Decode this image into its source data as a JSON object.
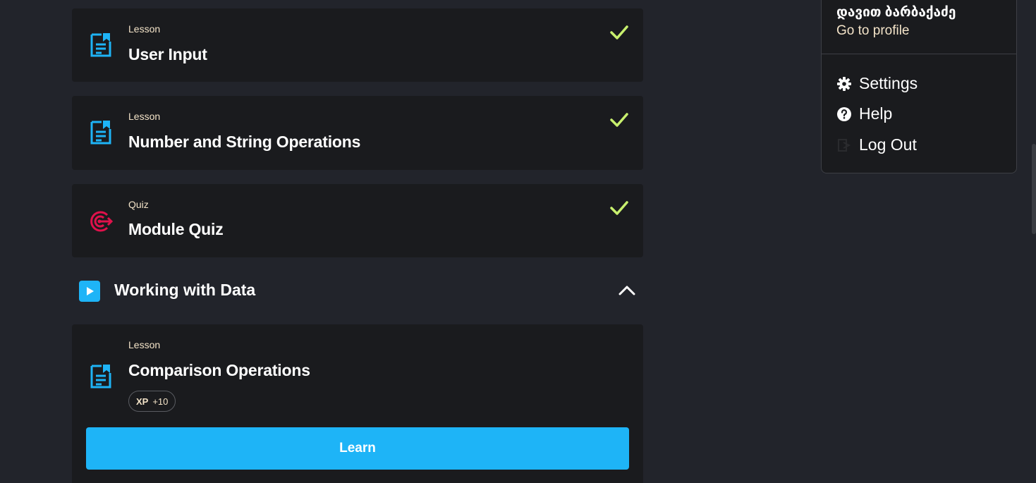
{
  "lessons": [
    {
      "type": "Lesson",
      "title": "User Input",
      "completed": true,
      "icon": "lesson-doc-icon"
    },
    {
      "type": "Lesson",
      "title": "Number and String Operations",
      "completed": true,
      "icon": "lesson-doc-icon"
    },
    {
      "type": "Quiz",
      "title": "Module Quiz",
      "completed": true,
      "icon": "quiz-target-icon"
    }
  ],
  "section": {
    "title": "Working with Data",
    "icon": "play-icon",
    "expanded": true
  },
  "current_lesson": {
    "type": "Lesson",
    "title": "Comparison Operations",
    "xp_label": "XP",
    "xp_value": "+10",
    "button_label": "Learn",
    "icon": "lesson-doc-icon"
  },
  "user_menu": {
    "user_name": "დავით ბარბაქაძე",
    "profile_link": "Go to profile",
    "items": [
      {
        "label": "Settings",
        "icon": "gear-icon"
      },
      {
        "label": "Help",
        "icon": "help-circle-icon"
      },
      {
        "label": "Log Out",
        "icon": "logout-icon"
      }
    ]
  },
  "colors": {
    "background": "#22242b",
    "card": "#1a1b1e",
    "accent_blue": "#1eb4f7",
    "check_green": "#c8f06e",
    "quiz_red": "#e0114b",
    "cream_text": "#f3e3c8"
  }
}
